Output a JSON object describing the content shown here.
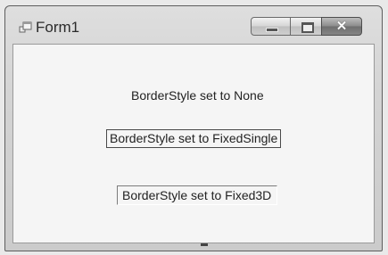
{
  "window": {
    "title": "Form1",
    "close_glyph": "✕"
  },
  "labels": {
    "none": "BorderStyle set to None",
    "fixed_single": "BorderStyle set to FixedSingle",
    "fixed_3d": "BorderStyle set to Fixed3D"
  },
  "icons": {
    "app": "form-window-icon",
    "minimize": "minimize-icon",
    "maximize": "maximize-icon",
    "close": "close-icon"
  }
}
